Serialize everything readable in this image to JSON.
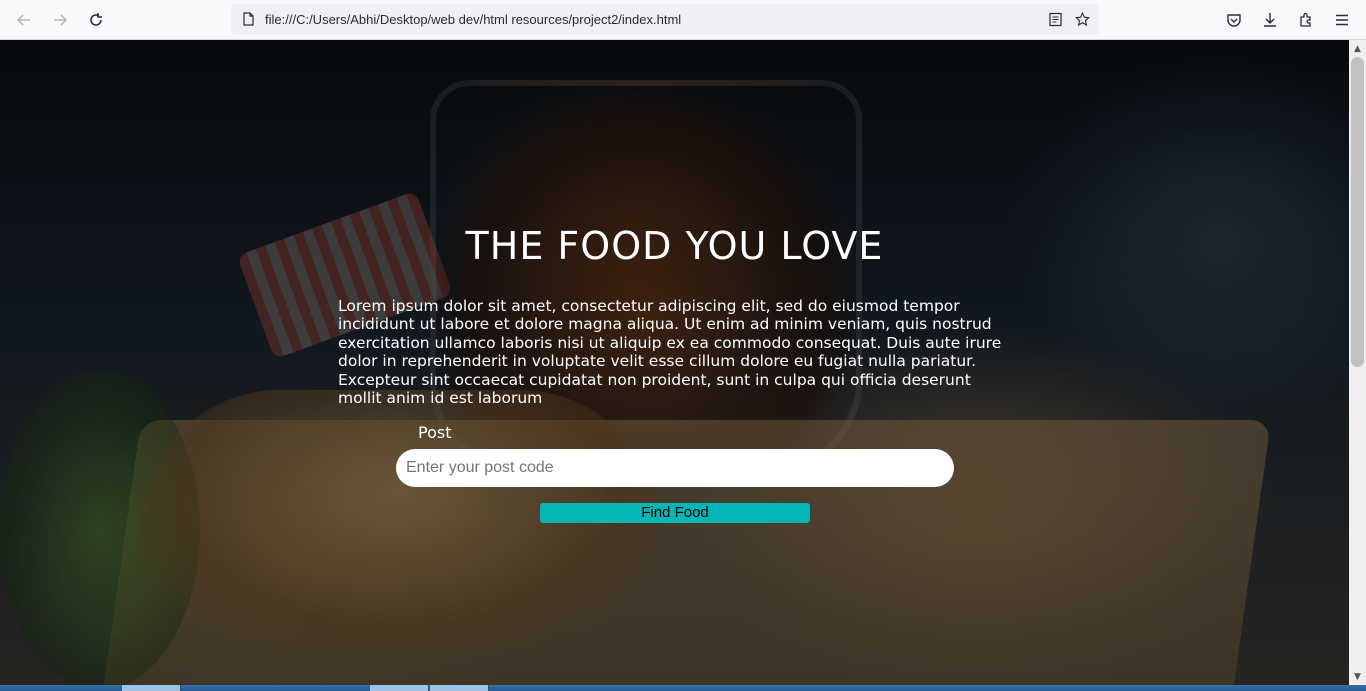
{
  "browser": {
    "url": "file:///C:/Users/Abhi/Desktop/web dev/html resources/project2/index.html",
    "icons": {
      "back": "arrow-left-icon",
      "forward": "arrow-right-icon",
      "reload": "reload-icon",
      "page": "page-icon",
      "reader_view": "reader-view-icon",
      "bookmark": "star-icon",
      "pocket": "pocket-icon",
      "downloads": "download-icon",
      "extensions": "extensions-icon",
      "menu": "hamburger-menu-icon"
    }
  },
  "hero": {
    "title": "THE FOOD YOU LOVE",
    "paragraph": "Lorem ipsum dolor sit amet, consectetur adipiscing elit, sed do eiusmod tempor incididunt ut labore et dolore magna aliqua. Ut enim ad minim veniam, quis nostrud exercitation ullamco laboris nisi ut aliquip ex ea commodo consequat. Duis aute irure dolor in reprehenderit in voluptate velit esse cillum dolore eu fugiat nulla pariatur. Excepteur sint occaecat cupidatat non proident, sunt in culpa qui officia deserunt mollit anim id est laborum",
    "form": {
      "label": "Post",
      "placeholder": "Enter your post code",
      "value": "",
      "button": "Find Food"
    }
  },
  "colors": {
    "button_bg": "#04b7b5",
    "text": "#ffffff"
  }
}
